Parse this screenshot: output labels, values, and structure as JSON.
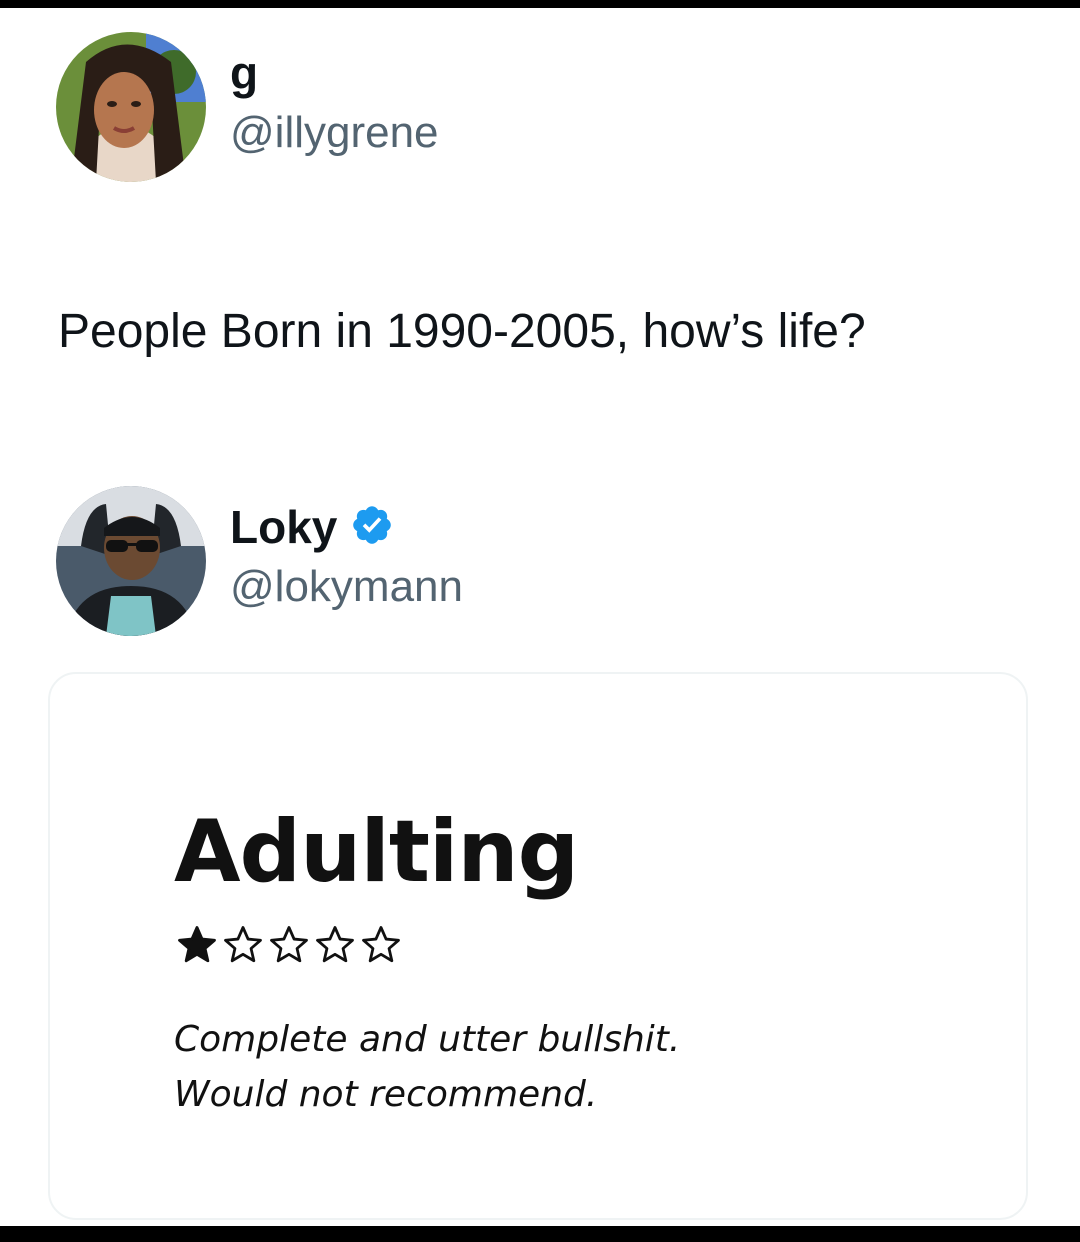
{
  "original_post": {
    "display_name": "g",
    "handle": "@illygrene",
    "text": "People Born in 1990-2005, how’s life?"
  },
  "reply_post": {
    "display_name": "Loky",
    "handle": "@lokymann",
    "verified": true,
    "verified_color": "#1d9bf0",
    "media_card": {
      "title": "Adulting",
      "rating": 1,
      "rating_max": 5,
      "review_line_1": "Complete and utter bullshit.",
      "review_line_2": "Would not recommend."
    }
  },
  "colors": {
    "text_primary": "#0f1419",
    "text_secondary": "#536471",
    "card_border": "#eff3f4"
  },
  "icons": [
    "avatar-photo",
    "verified-badge-icon",
    "star-filled-icon",
    "star-outline-icon"
  ]
}
